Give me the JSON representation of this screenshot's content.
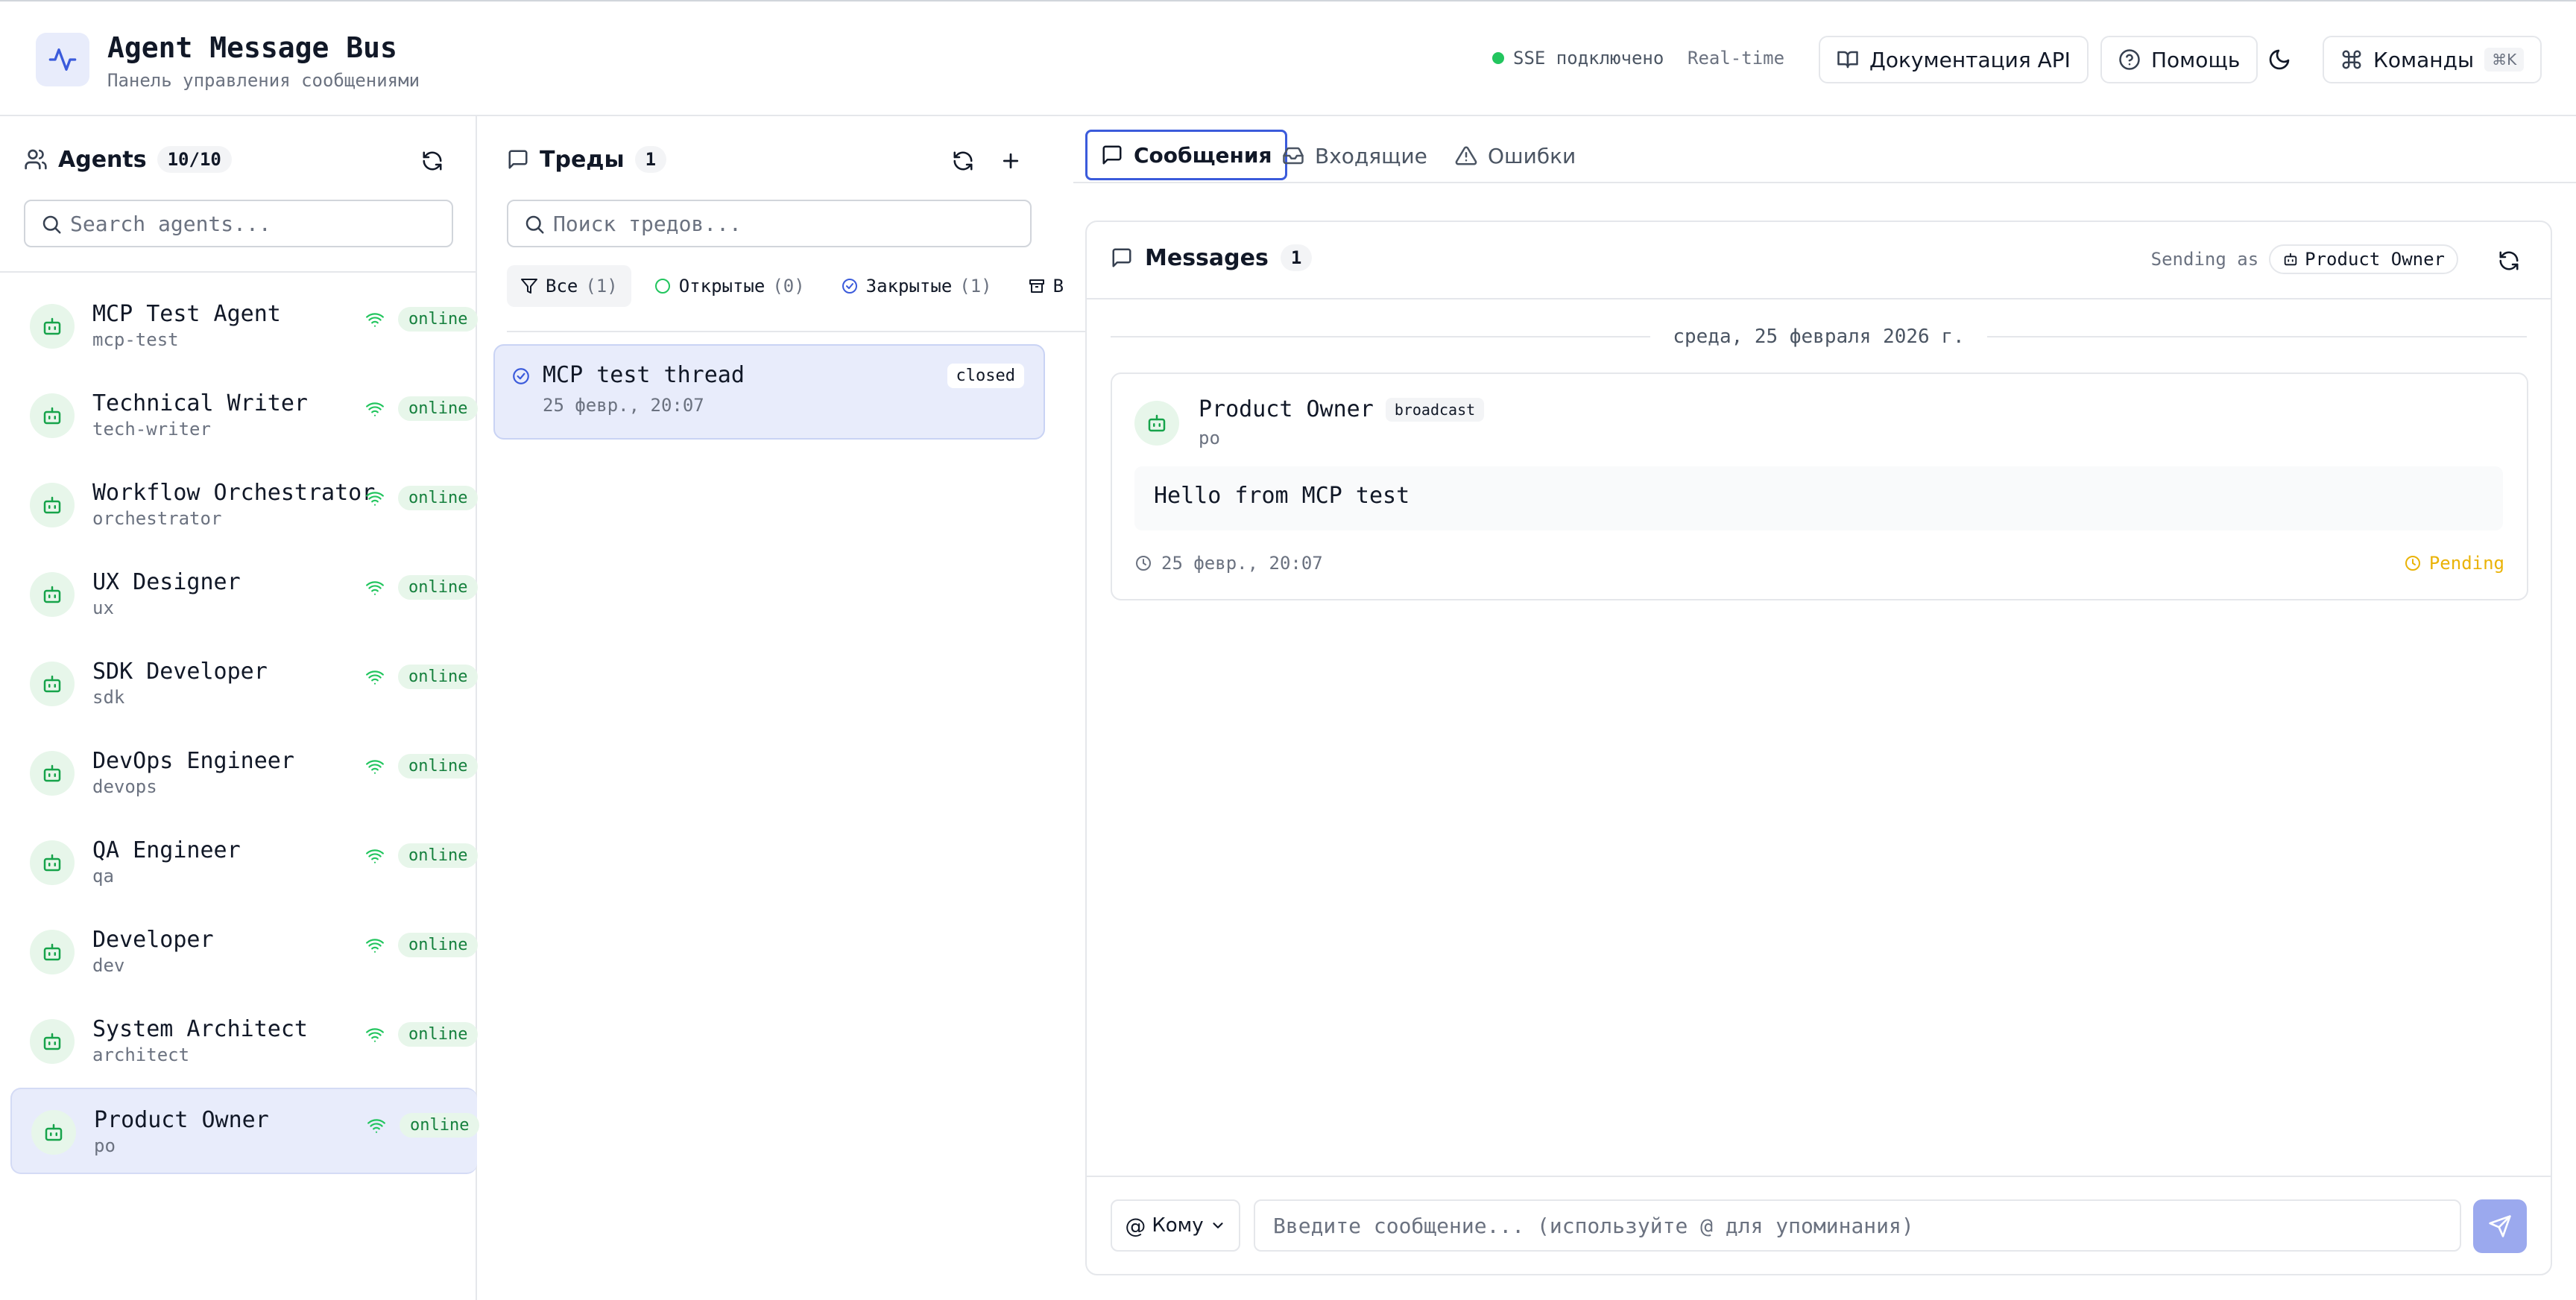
{
  "header": {
    "title": "Agent Message Bus",
    "subtitle": "Панель управления сообщениями",
    "sse_status": "SSE подключено",
    "realtime": "Real-time",
    "api_docs": "Документация API",
    "help": "Помощь",
    "commands": "Команды",
    "commands_shortcut": "⌘K"
  },
  "agents": {
    "title": "Agents",
    "count": "10/10",
    "search_placeholder": "Search agents...",
    "status_label": "online",
    "items": [
      {
        "name": "MCP Test Agent",
        "id": "mcp-test"
      },
      {
        "name": "Technical Writer",
        "id": "tech-writer"
      },
      {
        "name": "Workflow Orchestrator",
        "id": "orchestrator"
      },
      {
        "name": "UX Designer",
        "id": "ux"
      },
      {
        "name": "SDK Developer",
        "id": "sdk"
      },
      {
        "name": "DevOps Engineer",
        "id": "devops"
      },
      {
        "name": "QA Engineer",
        "id": "qa"
      },
      {
        "name": "Developer",
        "id": "dev"
      },
      {
        "name": "System Architect",
        "id": "architect"
      },
      {
        "name": "Product Owner",
        "id": "po"
      }
    ]
  },
  "threads": {
    "title": "Треды",
    "count": "1",
    "search_placeholder": "Поиск тредов...",
    "filters": [
      {
        "label": "Все",
        "count": "(1)"
      },
      {
        "label": "Открытые",
        "count": "(0)"
      },
      {
        "label": "Закрытые",
        "count": "(1)"
      },
      {
        "label": "В",
        "count": ""
      }
    ],
    "items": [
      {
        "title": "MCP test thread",
        "time": "25 февр., 20:07",
        "status": "closed"
      }
    ]
  },
  "tabs": [
    {
      "label": "Сообщения"
    },
    {
      "label": "Входящие"
    },
    {
      "label": "Ошибки"
    }
  ],
  "messages": {
    "title": "Messages",
    "count": "1",
    "sending_as_label": "Sending as",
    "sending_as_agent": "Product Owner",
    "date_separator": "среда, 25 февраля 2026 г.",
    "items": [
      {
        "sender": "Product Owner",
        "badge": "broadcast",
        "sender_id": "po",
        "body": "Hello from MCP test",
        "time": "25 февр., 20:07",
        "status": "Pending"
      }
    ],
    "to_label": "Кому",
    "compose_placeholder": "Введите сообщение... (используйте @ для упоминания)"
  },
  "colors": {
    "accent": "#3b5bdb",
    "online": "#15803d",
    "pending": "#eab308",
    "selected_bg": "#e8ecfb"
  }
}
